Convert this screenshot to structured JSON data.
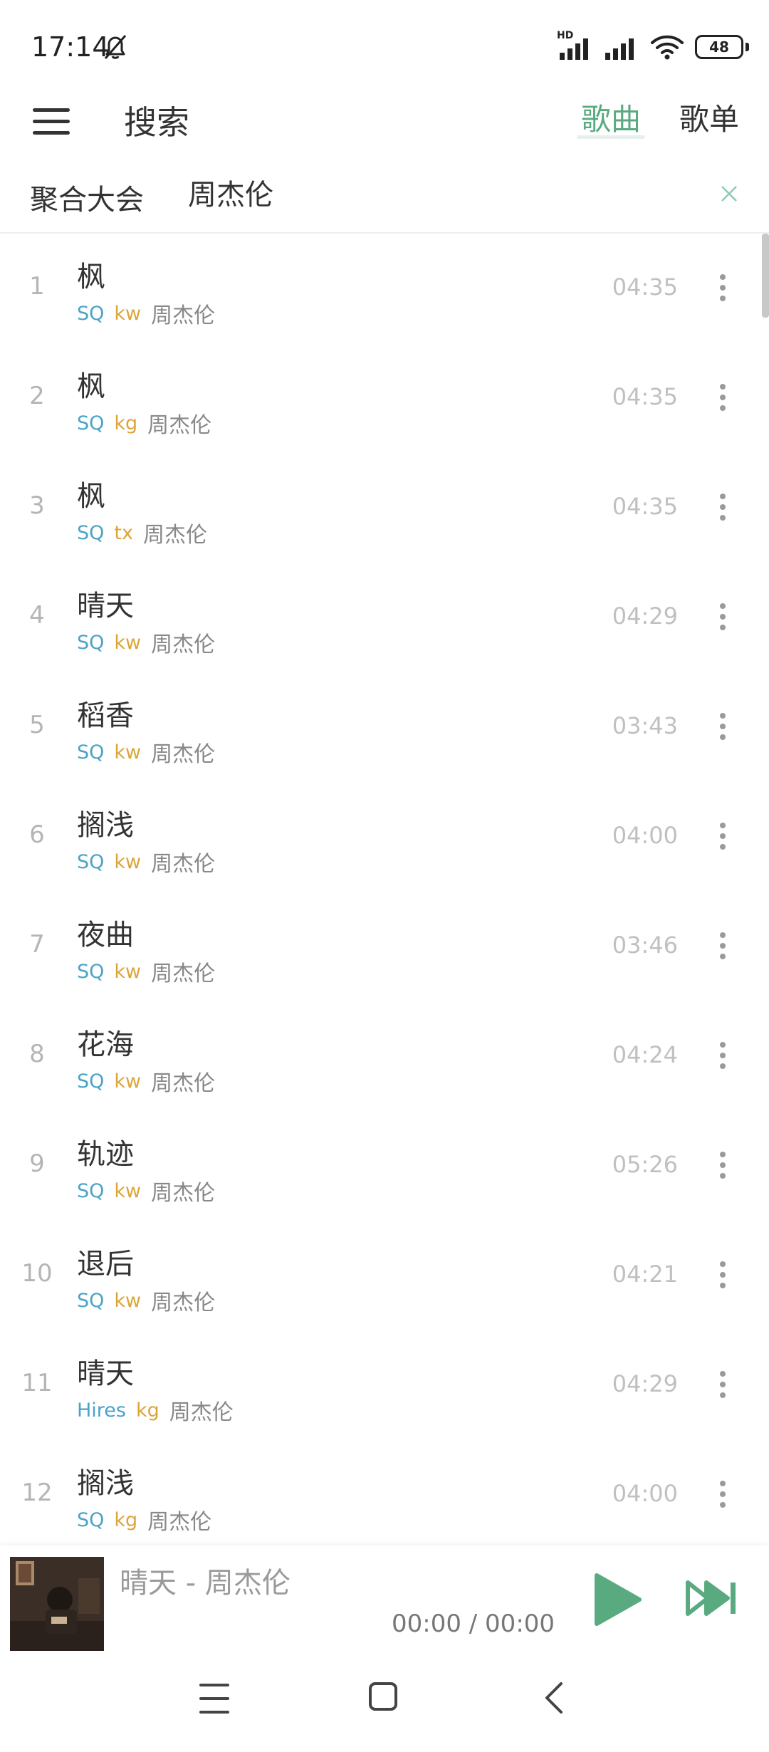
{
  "status_bar": {
    "time": "17:14",
    "hd": "HD",
    "battery": "48"
  },
  "header": {
    "title": "搜索",
    "tabs": [
      {
        "label": "歌曲",
        "active": true
      },
      {
        "label": "歌单",
        "active": false
      }
    ]
  },
  "search": {
    "source": "聚合大会",
    "query": "周杰伦"
  },
  "songs": [
    {
      "index": "1",
      "title": "枫",
      "quality": "SQ",
      "source": "kw",
      "artist": "周杰伦",
      "duration": "04:35"
    },
    {
      "index": "2",
      "title": "枫",
      "quality": "SQ",
      "source": "kg",
      "artist": "周杰伦",
      "duration": "04:35"
    },
    {
      "index": "3",
      "title": "枫",
      "quality": "SQ",
      "source": "tx",
      "artist": "周杰伦",
      "duration": "04:35"
    },
    {
      "index": "4",
      "title": "晴天",
      "quality": "SQ",
      "source": "kw",
      "artist": "周杰伦",
      "duration": "04:29"
    },
    {
      "index": "5",
      "title": "稻香",
      "quality": "SQ",
      "source": "kw",
      "artist": "周杰伦",
      "duration": "03:43"
    },
    {
      "index": "6",
      "title": "搁浅",
      "quality": "SQ",
      "source": "kw",
      "artist": "周杰伦",
      "duration": "04:00"
    },
    {
      "index": "7",
      "title": "夜曲",
      "quality": "SQ",
      "source": "kw",
      "artist": "周杰伦",
      "duration": "03:46"
    },
    {
      "index": "8",
      "title": "花海",
      "quality": "SQ",
      "source": "kw",
      "artist": "周杰伦",
      "duration": "04:24"
    },
    {
      "index": "9",
      "title": "轨迹",
      "quality": "SQ",
      "source": "kw",
      "artist": "周杰伦",
      "duration": "05:26"
    },
    {
      "index": "10",
      "title": "退后",
      "quality": "SQ",
      "source": "kw",
      "artist": "周杰伦",
      "duration": "04:21"
    },
    {
      "index": "11",
      "title": "晴天",
      "quality": "Hires",
      "source": "kg",
      "artist": "周杰伦",
      "duration": "04:29"
    },
    {
      "index": "12",
      "title": "搁浅",
      "quality": "SQ",
      "source": "kg",
      "artist": "周杰伦",
      "duration": "04:00"
    }
  ],
  "player": {
    "now_playing": "晴天 - 周杰伦",
    "time": "00:00 / 00:00"
  },
  "icons": {
    "menu": "hamburger-icon",
    "clear": "close-icon",
    "more": "more-vertical-icon",
    "play": "play-icon",
    "next": "skip-next-icon"
  },
  "colors": {
    "accent": "#5aaa80",
    "quality_tag": "#4ba3c7",
    "source_tag": "#dba53a",
    "muted_text": "#b5b5b5"
  }
}
